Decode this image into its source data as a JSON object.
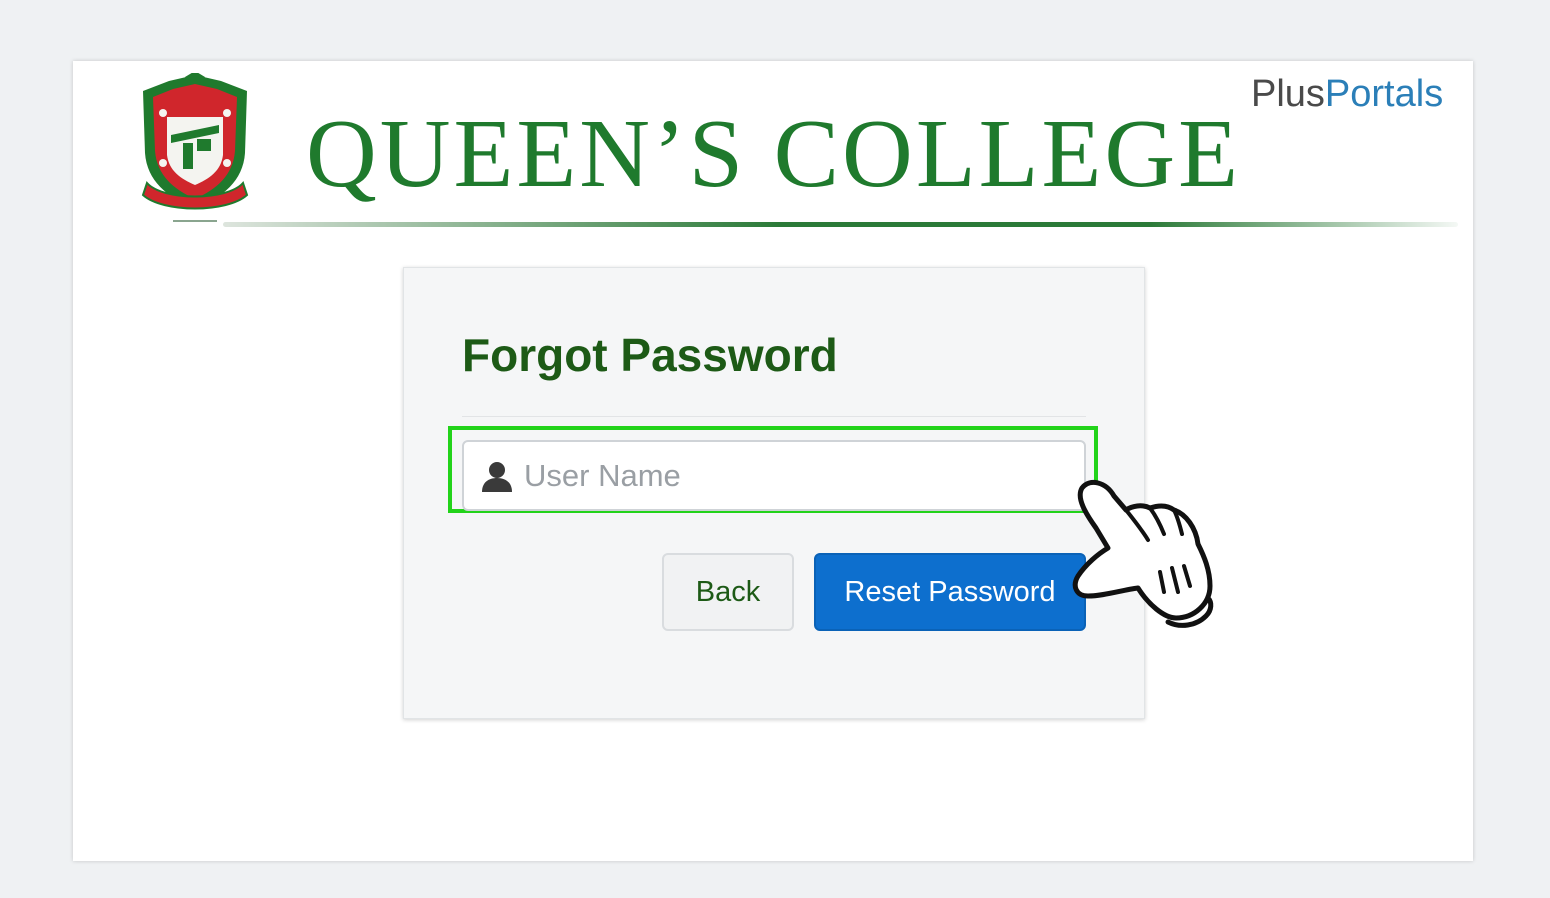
{
  "header": {
    "college_name": "QUEEN’S COLLEGE",
    "brand_plus": "Plus",
    "brand_portals": "Portals",
    "crest_icon": "school-crest-icon"
  },
  "form": {
    "title": "Forgot Password",
    "username": {
      "placeholder": "User Name",
      "value": "",
      "icon": "user-icon"
    },
    "back_label": "Back",
    "reset_label": "Reset Password"
  },
  "overlay": {
    "cursor_icon": "hand-pointer-icon",
    "highlight_color": "#22d31a"
  },
  "colors": {
    "background": "#eff1f3",
    "title_green": "#1d5a16",
    "college_green": "#1f7a2d",
    "primary_button": "#0d6fce",
    "brand_blue": "#2b7fb8"
  }
}
